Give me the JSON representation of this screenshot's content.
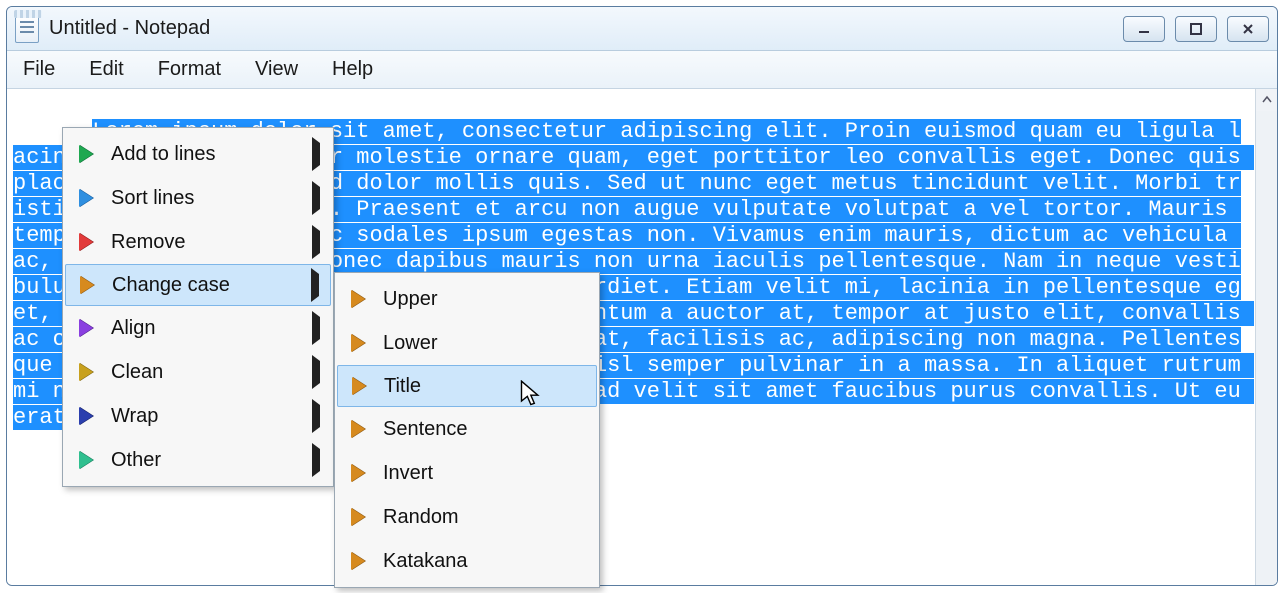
{
  "window": {
    "title": "Untitled - Notepad"
  },
  "menubar": {
    "items": [
      "File",
      "Edit",
      "Format",
      "View",
      "Help"
    ]
  },
  "editor": {
    "text": "Lorem ipsum dolor sit amet, consectetur adipiscing elit. Proin euismod quam eu ligula lacinia convallis. Integer molestie ornare quam, eget porttitor leo convallis eget. Donec quis placerat arcu, a eleifend dolor mollis quis. Sed ut nunc eget metus tincidunt velit. Morbi tristique mattis consequat. Praesent et arcu non augue vulputate volutpat a vel tortor. Mauris tempus venenatis sem, nec sodales ipsum egestas non. Vivamus enim mauris, dictum ac vehicula ac, sagittis quis dui. Donec dapibus mauris non urna iaculis pellentesque. Nam in neque vestibulum pellentesque. Quisque gravida vel imperdiet. Etiam velit mi, lacinia in pellentesque eget, egestas ut leo. Nisl lectus risus, elementum a auctor at, tempor at justo elit, convallis ac ornare in, pharetra id leo. Nulla consequat, facilisis ac, adipiscing non magna. Pellentesque ac leo sed libero. Cras vel libero nec nisl semper pulvinar in a massa. In aliquet rutrum mi nec vestibulum. Nunc sollicitudin varius ad velit sit amet faucibus purus convallis. Ut eu erat nulla."
  },
  "context_menu_main": {
    "items": [
      {
        "label": "Add to lines",
        "icon": "green",
        "submenu": true
      },
      {
        "label": "Sort lines",
        "icon": "blue",
        "submenu": true
      },
      {
        "label": "Remove",
        "icon": "red",
        "submenu": true
      },
      {
        "label": "Change case",
        "icon": "orange",
        "submenu": true,
        "hover": true
      },
      {
        "label": "Align",
        "icon": "purple",
        "submenu": true
      },
      {
        "label": "Clean",
        "icon": "gold",
        "submenu": true
      },
      {
        "label": "Wrap",
        "icon": "navy",
        "submenu": true
      },
      {
        "label": "Other",
        "icon": "mint",
        "submenu": true
      }
    ]
  },
  "context_menu_sub": {
    "items": [
      {
        "label": "Upper",
        "icon": "orange"
      },
      {
        "label": "Lower",
        "icon": "orange"
      },
      {
        "label": "Title",
        "icon": "orange",
        "hover": true
      },
      {
        "label": "Sentence",
        "icon": "orange"
      },
      {
        "label": "Invert",
        "icon": "orange"
      },
      {
        "label": "Random",
        "icon": "orange"
      },
      {
        "label": "Katakana",
        "icon": "orange"
      }
    ]
  }
}
